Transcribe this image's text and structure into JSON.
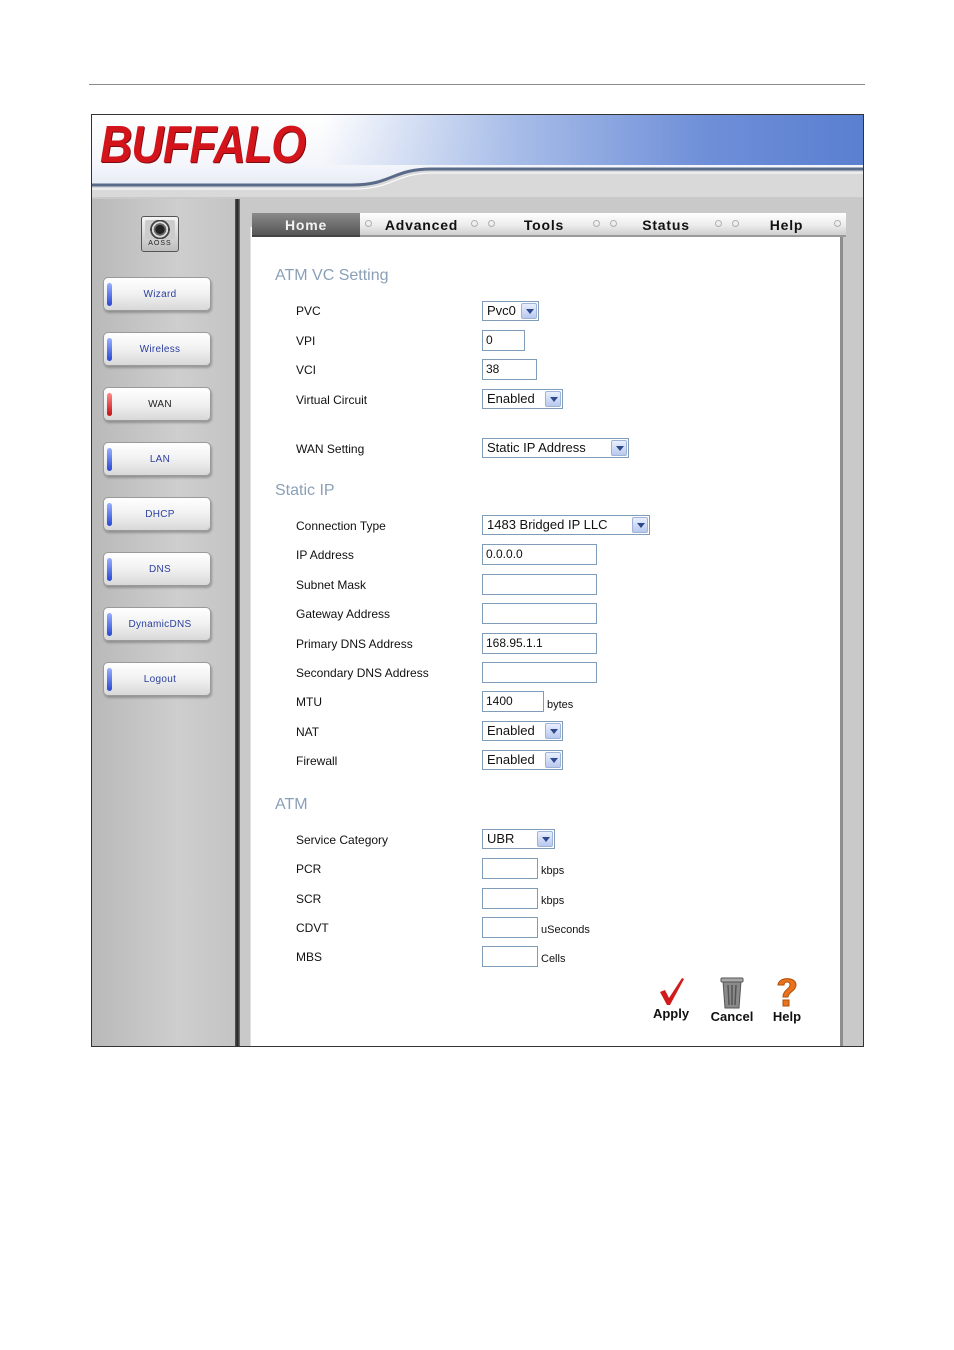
{
  "brand": {
    "logo_text": "BUFFALO",
    "logo_color": "#d4141b"
  },
  "aoss": {
    "label": "AOSS"
  },
  "sidebar": {
    "items": [
      {
        "label": "Wizard",
        "active": false
      },
      {
        "label": "Wireless",
        "active": false
      },
      {
        "label": "WAN",
        "active": true
      },
      {
        "label": "LAN",
        "active": false
      },
      {
        "label": "DHCP",
        "active": false
      },
      {
        "label": "DNS",
        "active": false
      },
      {
        "label": "DynamicDNS",
        "active": false
      },
      {
        "label": "Logout",
        "active": false
      }
    ]
  },
  "tabs": [
    {
      "label": "Home",
      "active": true
    },
    {
      "label": "Advanced",
      "active": false
    },
    {
      "label": "Tools",
      "active": false
    },
    {
      "label": "Status",
      "active": false
    },
    {
      "label": "Help",
      "active": false
    }
  ],
  "atm_vc": {
    "title": "ATM VC Setting",
    "pvc_label": "PVC",
    "pvc_value": "Pvc0",
    "vpi_label": "VPI",
    "vpi_value": "0",
    "vci_label": "VCI",
    "vci_value": "38",
    "vc_label": "Virtual Circuit",
    "vc_value": "Enabled",
    "wan_label": "WAN Setting",
    "wan_value": "Static IP Address"
  },
  "static_ip": {
    "title": "Static IP",
    "conn_type_label": "Connection Type",
    "conn_type_value": "1483 Bridged IP LLC",
    "ip_label": "IP Address",
    "ip_value": "0.0.0.0",
    "subnet_label": "Subnet Mask",
    "subnet_value": "",
    "gateway_label": "Gateway Address",
    "gateway_value": "",
    "dns1_label": "Primary DNS Address",
    "dns1_value": "168.95.1.1",
    "dns2_label": "Secondary DNS Address",
    "dns2_value": "",
    "mtu_label": "MTU",
    "mtu_value": "1400",
    "mtu_unit": "bytes",
    "nat_label": "NAT",
    "nat_value": "Enabled",
    "firewall_label": "Firewall",
    "firewall_value": "Enabled"
  },
  "atm": {
    "title": "ATM",
    "service_label": "Service Category",
    "service_value": "UBR",
    "pcr_label": "PCR",
    "pcr_value": "",
    "pcr_unit": "kbps",
    "scr_label": "SCR",
    "scr_value": "",
    "scr_unit": "kbps",
    "cdvt_label": "CDVT",
    "cdvt_value": "",
    "cdvt_unit": "uSeconds",
    "mbs_label": "MBS",
    "mbs_value": "",
    "mbs_unit": "Cells"
  },
  "actions": {
    "apply": "Apply",
    "cancel": "Cancel",
    "help": "Help"
  },
  "colors": {
    "section_title": "#8aa0b8",
    "nav_label": "#2b3fa0",
    "active_pill": "#c80f0f",
    "pill": "#2747d6"
  },
  "icons": [
    "checkmark-icon",
    "trash-can-icon",
    "question-mark-icon",
    "aoss-icon"
  ]
}
